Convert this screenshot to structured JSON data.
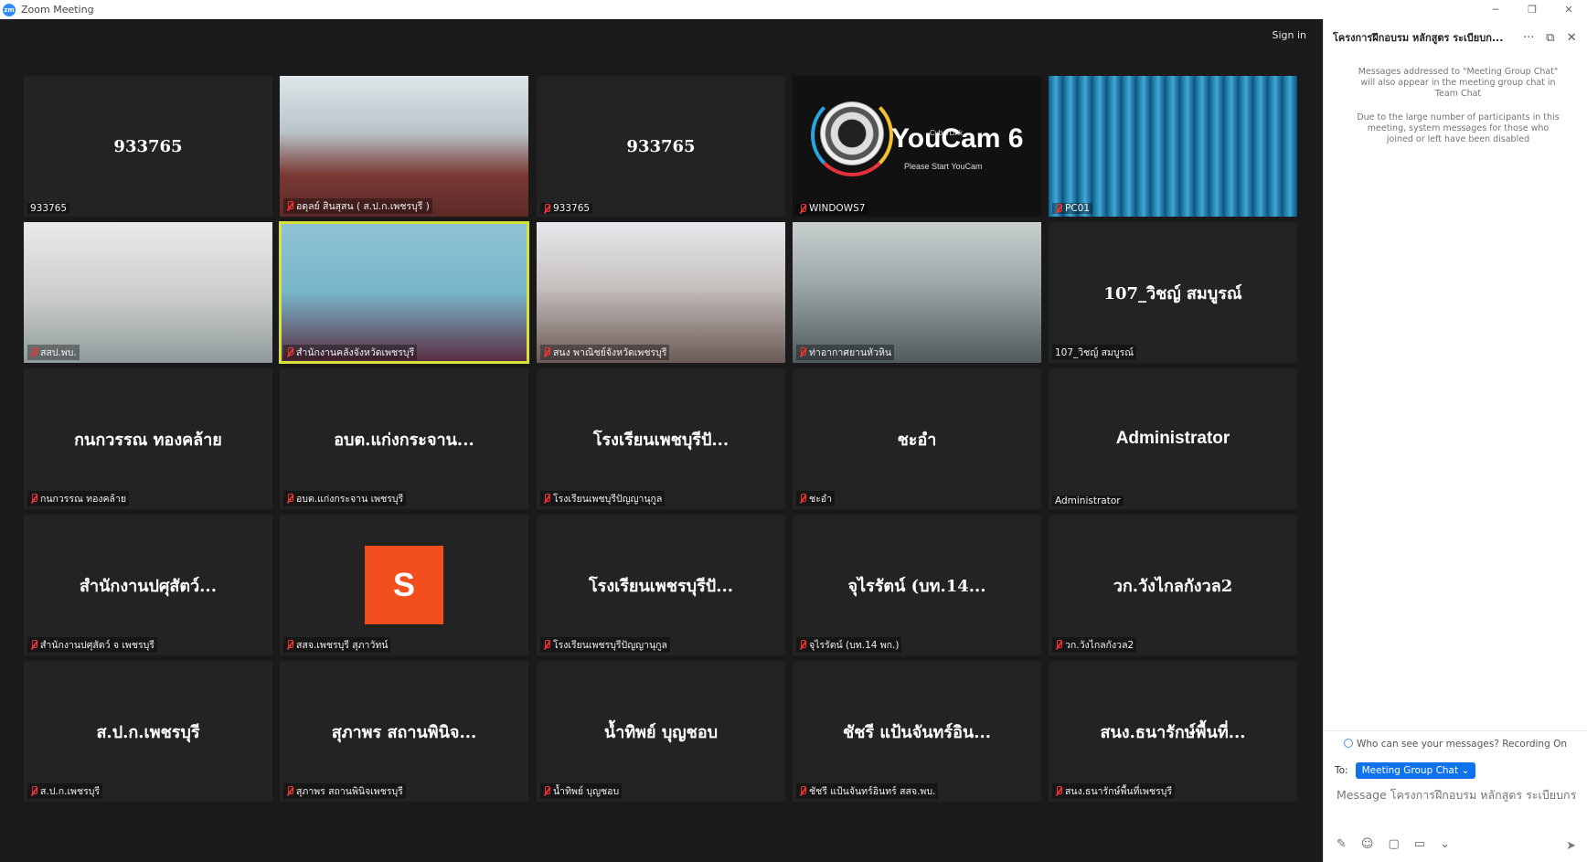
{
  "window": {
    "title": "Zoom Meeting",
    "logo": "zm",
    "controls": [
      "minimize-icon",
      "restore-icon",
      "close-icon"
    ],
    "control_glyphs": [
      "─",
      "❐",
      "✕"
    ]
  },
  "meeting": {
    "sign_in": "Sign in",
    "tiles": [
      {
        "display": "933765",
        "label": "933765",
        "muted": false
      },
      {
        "display": "",
        "label": "อดุลย์ สินสุสน ( ส.ป.ก.เพชรบุรี )",
        "muted": true,
        "video": "office"
      },
      {
        "display": "933765",
        "label": "933765",
        "muted": true
      },
      {
        "display": "",
        "label": "WINDOWS7",
        "muted": true,
        "video": "youcam"
      },
      {
        "display": "",
        "label": "PC01",
        "muted": true,
        "video": "curtain"
      },
      {
        "display": "",
        "label": "สสป.พบ.",
        "muted": true,
        "video": "room"
      },
      {
        "display": "",
        "label": "สำนักงานคลังจังหวัดเพชรบุรี",
        "muted": true,
        "video": "blue",
        "active": true
      },
      {
        "display": "",
        "label": "สนง พาณิชย์จังหวัดเพชรบุรี",
        "muted": true,
        "video": "face"
      },
      {
        "display": "",
        "label": "ท่าอากาศยานหัวหิน",
        "muted": true,
        "video": "hall"
      },
      {
        "display": "107_วิชญ์ สมบูรณ์",
        "label": "107_วิชญ์ สมบูรณ์",
        "muted": false
      },
      {
        "display": "กนกวรรณ ทองคล้าย",
        "label": "กนกวรรณ ทองคล้าย",
        "muted": true
      },
      {
        "display": "อบต.แก่งกระจาน...",
        "label": "อบต.แก่งกระจาน เพชรบุรี",
        "muted": true
      },
      {
        "display": "โรงเรียนเพชบุรีปั...",
        "label": "โรงเรียนเพชบุรีปัญญานุกูล",
        "muted": true
      },
      {
        "display": "ชะอำ",
        "label": "ชะอำ",
        "muted": true
      },
      {
        "display": "Administrator",
        "label": "Administrator",
        "muted": false,
        "latin": true
      },
      {
        "display": "สำนักงานปศุสัตว์...",
        "label": "สำนักงานปศุสัตว์ จ เพชรบุรี",
        "muted": true
      },
      {
        "display": "",
        "label": "สสจ.เพชรบุรี สุภาวัทน์",
        "muted": true,
        "avatar": "S"
      },
      {
        "display": "โรงเรียนเพชรบุรีปั...",
        "label": "โรงเรียนเพชรบุรีปัญญานุกูล",
        "muted": true
      },
      {
        "display": "จุไรรัตน์ (บท.14...",
        "label": "จุไรรัตน์ (บท.14 พก.)",
        "muted": true
      },
      {
        "display": "วก.วังไกลกังวล2",
        "label": "วก.วังไกลกังวล2",
        "muted": true
      },
      {
        "display": "ส.ป.ก.เพชรบุรี",
        "label": "ส.ป.ก.เพชรบุรี",
        "muted": true
      },
      {
        "display": "สุภาพร สถานพินิจ...",
        "label": "สุภาพร สถานพินิจเพชรบุรี",
        "muted": true
      },
      {
        "display": "น้ำทิพย์ บุญชอบ",
        "label": "น้ำทิพย์ บุญชอบ",
        "muted": true
      },
      {
        "display": "ชัชรี แป้นจันทร์อิน...",
        "label": "ชัชรี แป้นจันทร์อินทร์ สสจ.พบ.",
        "muted": true
      },
      {
        "display": "สนง.ธนารักษ์พื้นที่...",
        "label": "สนง.ธนารักษ์พื้นที่เพชรบุรี",
        "muted": true
      }
    ],
    "youcam": {
      "brand_small": "CyberLink",
      "brand": "YouCam 6",
      "sub": "Please Start YouCam"
    }
  },
  "chat": {
    "title": "โครงการฝึกอบรม หลักสูตร ระเบียบก...",
    "header_icons": [
      "more-icon",
      "popout-icon",
      "close-icon"
    ],
    "header_glyphs": [
      "···",
      "⧉",
      "✕"
    ],
    "system_messages": [
      "Messages addressed to \"Meeting Group Chat\" will also appear in the meeting group chat in Team Chat",
      "Due to the large number of participants in this meeting, system messages for those who joined or left have been disabled"
    ],
    "who_can_see": "Who can see your messages? Recording On",
    "to_label": "To:",
    "to_value": "Meeting Group Chat ⌄",
    "input_placeholder": "Message โครงการฝึกอบรม หลักสูตร ระเบียบกร...",
    "tool_glyphs": [
      "✎",
      "☺",
      "▢",
      "▭",
      "⌄"
    ],
    "send_glyph": "➤"
  },
  "colors": {
    "accent": "#0e72ed",
    "active_speaker": "#d8e03a",
    "tile_bg": "#232323",
    "meeting_bg": "#1a1a1a",
    "avatar": "#f24e1e"
  }
}
